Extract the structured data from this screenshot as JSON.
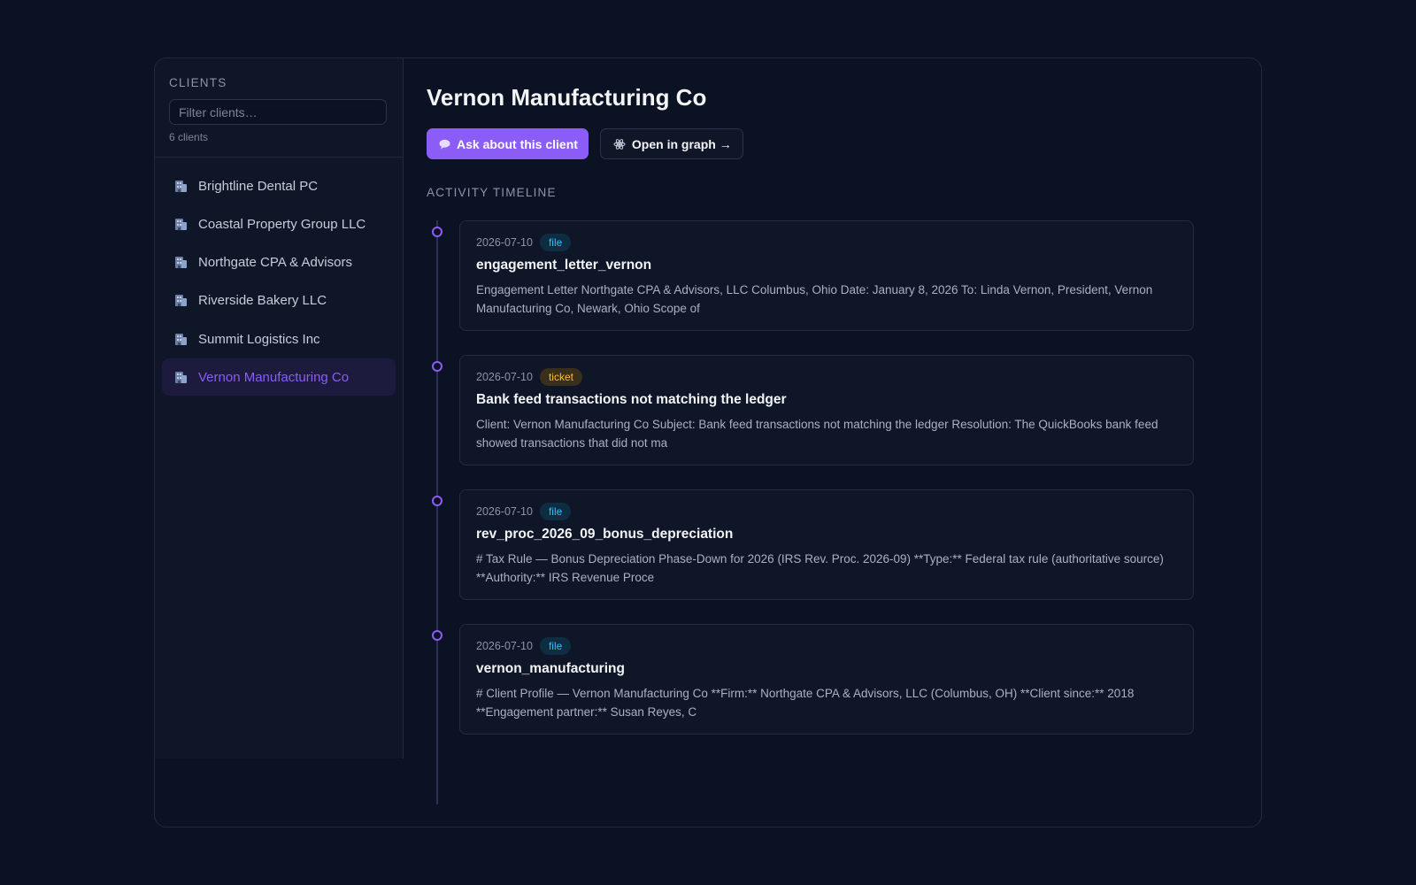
{
  "sidebar": {
    "title": "CLIENTS",
    "filter_placeholder": "Filter clients…",
    "count": "6 clients",
    "clients": [
      {
        "name": "Brightline Dental PC"
      },
      {
        "name": "Coastal Property Group LLC"
      },
      {
        "name": "Northgate CPA & Advisors"
      },
      {
        "name": "Riverside Bakery LLC"
      },
      {
        "name": "Summit Logistics Inc"
      },
      {
        "name": "Vernon Manufacturing Co"
      }
    ],
    "active_index": 5
  },
  "main": {
    "title": "Vernon Manufacturing Co",
    "ask_button": "Ask about this client",
    "graph_button": "Open in graph →",
    "timeline_label": "ACTIVITY TIMELINE",
    "timeline": [
      {
        "date": "2026-07-10",
        "type": "file",
        "title": "engagement_letter_vernon",
        "snippet": "Engagement Letter Northgate CPA & Advisors, LLC Columbus, Ohio Date: January 8, 2026 To: Linda Vernon, President, Vernon Manufacturing Co, Newark, Ohio Scope of"
      },
      {
        "date": "2026-07-10",
        "type": "ticket",
        "title": "Bank feed transactions not matching the ledger",
        "snippet": "Client: Vernon Manufacturing Co Subject: Bank feed transactions not matching the ledger Resolution: The QuickBooks bank feed showed transactions that did not ma"
      },
      {
        "date": "2026-07-10",
        "type": "file",
        "title": "rev_proc_2026_09_bonus_depreciation",
        "snippet": "# Tax Rule — Bonus Depreciation Phase-Down for 2026 (IRS Rev. Proc. 2026-09) **Type:** Federal tax rule (authoritative source) **Authority:** IRS Revenue Proce"
      },
      {
        "date": "2026-07-10",
        "type": "file",
        "title": "vernon_manufacturing",
        "snippet": "# Client Profile — Vernon Manufacturing Co **Firm:** Northgate CPA & Advisors, LLC (Columbus, OH) **Client since:** 2018 **Engagement partner:** Susan Reyes, C"
      }
    ]
  },
  "colors": {
    "background": "#0b1224",
    "accent": "#8b5cf6",
    "file_badge": "#38bdf8",
    "ticket_badge": "#fbbf24"
  },
  "icons": {
    "client": "building-icon",
    "ask": "chat-bubble-icon",
    "graph": "atom-icon"
  }
}
